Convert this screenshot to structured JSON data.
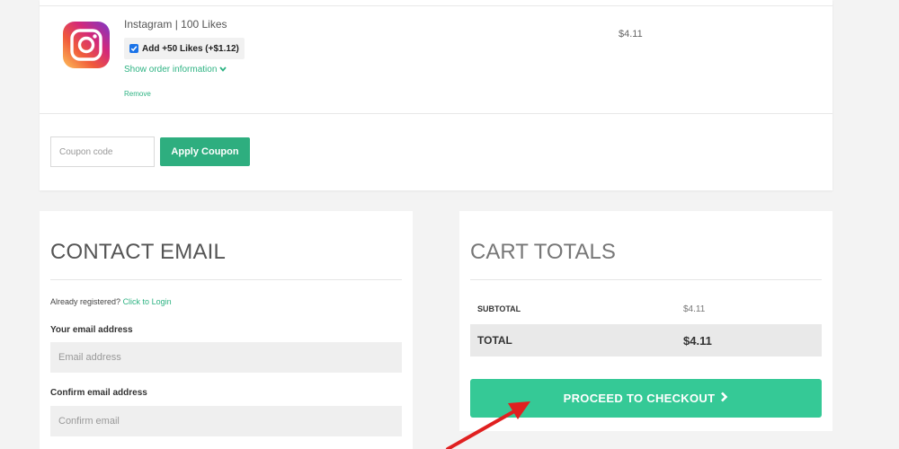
{
  "cart": {
    "product": {
      "name": "Instagram | 100 Likes",
      "addon_label": "Add +50 Likes (+$1.12)",
      "addon_checked": true,
      "order_info_label": "Show order information",
      "remove_label": "Remove",
      "price": "$4.11",
      "icon": "instagram-icon"
    },
    "coupon": {
      "placeholder": "Coupon code",
      "apply_label": "Apply Coupon"
    }
  },
  "contact": {
    "title": "CONTACT EMAIL",
    "registered_text": "Already registered?",
    "login_link": "Click to Login",
    "email_label": "Your email address",
    "email_placeholder": "Email address",
    "confirm_label": "Confirm email address",
    "confirm_placeholder": "Confirm email"
  },
  "totals": {
    "title": "CART TOTALS",
    "subtotal_label": "SUBTOTAL",
    "subtotal_value": "$4.11",
    "total_label": "TOTAL",
    "total_value": "$4.11",
    "checkout_label": "PROCEED TO CHECKOUT",
    "checkout_icon": "chevron-right-icon"
  },
  "colors": {
    "accent_green": "#2eae7f",
    "checkout_green": "#35c996",
    "link_green": "#2eb383",
    "annotation_red": "#e02020"
  }
}
